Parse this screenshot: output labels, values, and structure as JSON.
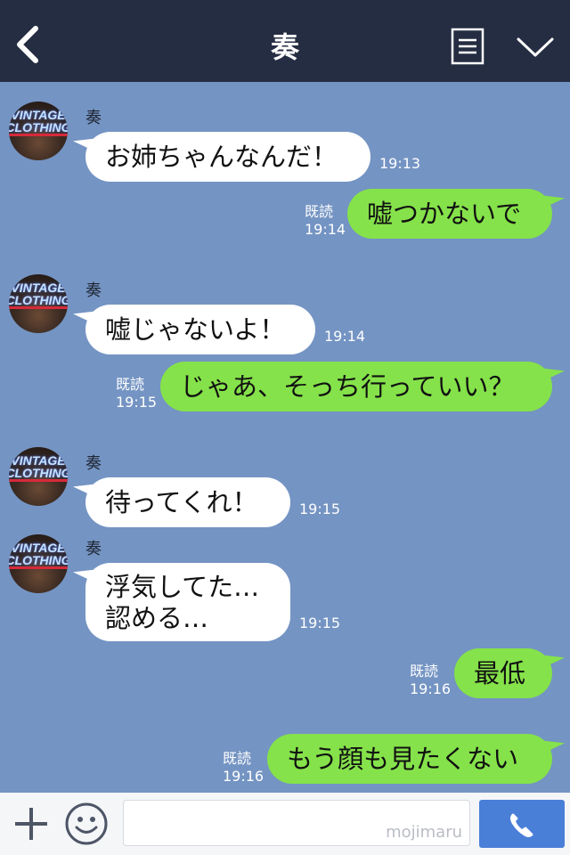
{
  "header": {
    "title": "奏"
  },
  "avatar": {
    "line1": "VINTAGE",
    "line2": "CLOTHING"
  },
  "messages": [
    {
      "sender": "奏",
      "text": "お姉ちゃんなんだ！",
      "time": "19:13"
    },
    {
      "text": "嘘つかないで",
      "read": "既読",
      "time": "19:14"
    },
    {
      "sender": "奏",
      "text": "嘘じゃないよ！",
      "time": "19:14"
    },
    {
      "text": "じゃあ、そっち行っていい？",
      "read": "既読",
      "time": "19:15"
    },
    {
      "sender": "奏",
      "text": "待ってくれ！",
      "time": "19:15"
    },
    {
      "sender": "奏",
      "line1": "浮気してた…",
      "line2": "認める…",
      "time": "19:15"
    },
    {
      "text": "最低",
      "read": "既読",
      "time": "19:16"
    },
    {
      "text": "もう顔も見たくない",
      "read": "既読",
      "time": "19:16"
    }
  ],
  "input": {
    "watermark": "mojimaru"
  },
  "colors": {
    "background": "#7494c3",
    "header": "#252d42",
    "outgoing": "#85e24a",
    "incoming": "#ffffff",
    "call": "#4a7fd8"
  },
  "icons": [
    "back-arrow-icon",
    "menu-icon",
    "chevron-down-icon",
    "plus-icon",
    "smile-icon",
    "phone-icon"
  ]
}
